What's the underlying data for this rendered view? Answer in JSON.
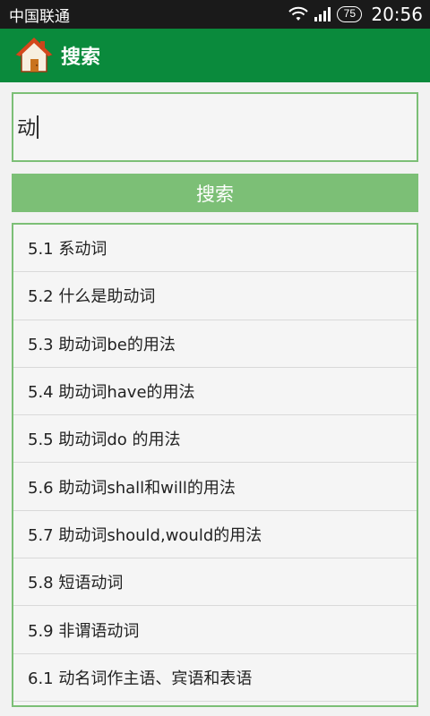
{
  "status_bar": {
    "carrier": "中国联通",
    "battery": "75",
    "time": "20:56",
    "icons": [
      "wifi-icon",
      "signal-icon",
      "battery-icon"
    ]
  },
  "app_bar": {
    "title": "搜索",
    "icon": "home-icon",
    "background_color": "#0a8a3c"
  },
  "search": {
    "value": "动",
    "button_label": "搜索",
    "accent_color": "#7cbf76"
  },
  "results": [
    "5.1 系动词",
    "5.2 什么是助动词",
    "5.3 助动词be的用法",
    "5.4 助动词have的用法",
    "5.5 助动词do 的用法",
    "5.6 助动词shall和will的用法",
    "5.7 助动词should,would的用法",
    "5.8 短语动词",
    "5.9 非谓语动词",
    "6.1 动名词作主语、宾语和表语"
  ]
}
